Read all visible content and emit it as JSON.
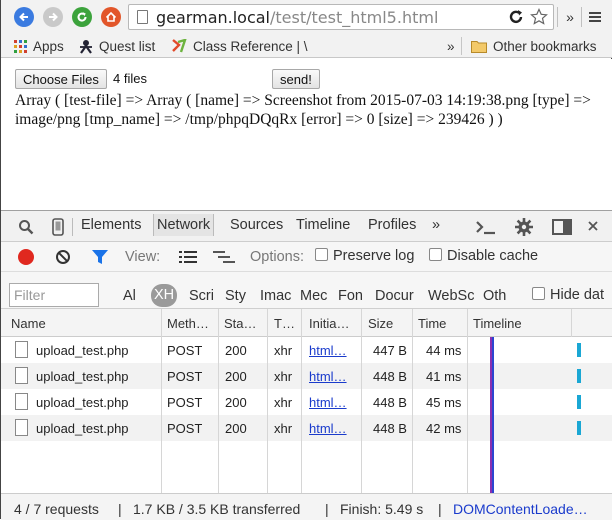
{
  "browser": {
    "url_host": "gearman.local",
    "url_path": "/test/test_html5.html",
    "overflow_label": "»"
  },
  "bookmarks": {
    "items": [
      {
        "label": "Apps",
        "icon": "apps-grid-icon"
      },
      {
        "label": "Quest list",
        "icon": "quest-icon"
      },
      {
        "label": "Class Reference | \\",
        "icon": "bookmark-flag-icon"
      }
    ],
    "overflow_label": "»",
    "other_label": "Other bookmarks"
  },
  "page": {
    "choose_files_label": "Choose Files",
    "file_status": "4 files",
    "send_label": "send!",
    "result_text": "Array ( [test-file] => Array ( [name] => Screenshot from 2015-07-03 14:19:38.png [type] => image/png [tmp_name] => /tmp/phpqDQqRx [error] => 0 [size] => 239426 ) )"
  },
  "devtools": {
    "tabs": [
      "Elements",
      "Network",
      "Sources",
      "Timeline",
      "Profiles"
    ],
    "tabs_overflow": "»",
    "active_tab": "Network",
    "view_label": "View:",
    "options_label": "Options:",
    "preserve_log_label": "Preserve log",
    "disable_cache_label": "Disable cache",
    "filter_placeholder": "Filter",
    "type_filters": [
      "Al",
      "XH",
      "Scri",
      "Sty",
      "Imac",
      "Mec",
      "Fon",
      "Docur",
      "WebSc",
      "Oth"
    ],
    "active_filter": "XH",
    "hide_data_label": "Hide dat",
    "columns": [
      "Name",
      "Meth…",
      "Sta…",
      "T…",
      "Initia…",
      "Size",
      "Time",
      "Timeline"
    ],
    "rows": [
      {
        "name": "upload_test.php",
        "method": "POST",
        "status": "200",
        "type": "xhr",
        "initiator": "html…",
        "size": "447 B",
        "time": "44 ms"
      },
      {
        "name": "upload_test.php",
        "method": "POST",
        "status": "200",
        "type": "xhr",
        "initiator": "html…",
        "size": "448 B",
        "time": "41 ms"
      },
      {
        "name": "upload_test.php",
        "method": "POST",
        "status": "200",
        "type": "xhr",
        "initiator": "html…",
        "size": "448 B",
        "time": "45 ms"
      },
      {
        "name": "upload_test.php",
        "method": "POST",
        "status": "200",
        "type": "xhr",
        "initiator": "html…",
        "size": "448 B",
        "time": "42 ms"
      }
    ],
    "status": {
      "requests": "4 / 7 requests",
      "transferred": "1.7 KB / 3.5 KB transferred",
      "finish": "Finish: 5.49 s",
      "dom_content_loaded": "DOMContentLoade…"
    },
    "colors": {
      "record": "#e0281f",
      "timeline_purple": "#8a2fb0",
      "timeline_bar": "#1aa7d4",
      "link": "#1a3bcc"
    }
  }
}
